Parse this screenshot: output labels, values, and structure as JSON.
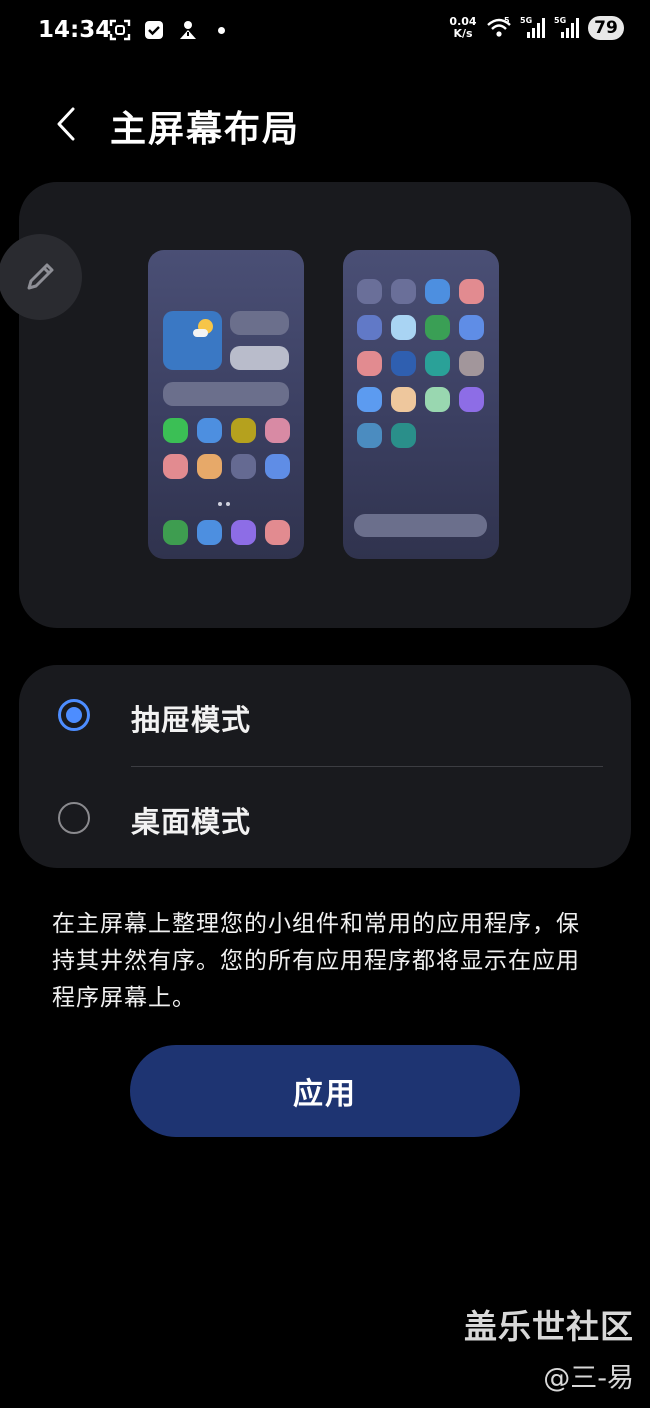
{
  "status_bar": {
    "time": "14:34",
    "net_speed_value": "0.04",
    "net_speed_unit": "K/s",
    "wifi_label": "5",
    "sim1_label": "5G",
    "sim2_label": "5G",
    "battery": "79",
    "icons": [
      "scan-icon",
      "check-shield-icon",
      "person-alert-icon",
      "notification-dot-icon",
      "wifi-icon",
      "signal-icon",
      "signal-icon",
      "battery-icon"
    ]
  },
  "header": {
    "back_icon": "chevron-left-icon",
    "title": "主屏幕布局"
  },
  "preview": {
    "edit_icon": "pencil-icon",
    "home_screen_app_colors": [
      "#3bbf55",
      "#4d8fe0",
      "#b5a11e",
      "#d88aa4",
      "#e28b90",
      "#e7a969",
      "#656a92",
      "#5f8de6"
    ],
    "dock_app_colors": [
      "#3e9d50",
      "#4d8fe0",
      "#8d6de6",
      "#e28b90"
    ],
    "drawer_app_colors": [
      "#6a6f99",
      "#6a6f99",
      "#4d8fe0",
      "#e28b90",
      "#6179c7",
      "#a9d4f3",
      "#3a9f55",
      "#5f8de6",
      "#e28b90",
      "#2f5fb0",
      "#2aa198",
      "#a2969b",
      "#5c9bf0",
      "#eec79d",
      "#99d7b0",
      "#8d6de6",
      "#4b8cc0",
      "#2a8f8a"
    ]
  },
  "modes": [
    {
      "label": "抽屉模式",
      "selected": true
    },
    {
      "label": "桌面模式",
      "selected": false
    }
  ],
  "description": "在主屏幕上整理您的小组件和常用的应用程序，保持其井然有序。您的所有应用程序都将显示在应用程序屏幕上。",
  "apply_button_label": "应用",
  "watermark": {
    "title": "盖乐世社区",
    "user": "@三-易"
  },
  "colors": {
    "background": "#000000",
    "card": "#191a1e",
    "accent": "#4d8dff",
    "apply_button": "#1e3472"
  }
}
